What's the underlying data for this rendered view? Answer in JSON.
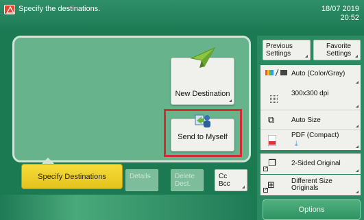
{
  "header": {
    "message": "Specify the destinations.",
    "date": "18/07 2019",
    "time": "20:52"
  },
  "main": {
    "new_destination_label": "New Destination",
    "send_to_myself_label": "Send to Myself"
  },
  "bottom": {
    "specify_destinations_label": "Specify Destinations",
    "details_label": "Details",
    "delete_line1": "Delete",
    "delete_line2": "Dest.",
    "cc_label": "Cc",
    "bcc_label": "Bcc"
  },
  "settings": {
    "previous_line1": "Previous",
    "previous_line2": "Settings",
    "favorite_line1": "Favorite",
    "favorite_line2": "Settings",
    "color_mode": "Auto (Color/Gray)",
    "resolution": "300x300 dpi",
    "size": "Auto Size",
    "file_format": "PDF (Compact)",
    "sided": "2-Sided Original",
    "different_size_line1": "Different Size",
    "different_size_line2": "Originals",
    "options_label": "Options"
  },
  "colors": {
    "accent_yellow": "#f6dc3a",
    "highlight_red": "#d42a34",
    "panel_green": "#1c7a53"
  }
}
